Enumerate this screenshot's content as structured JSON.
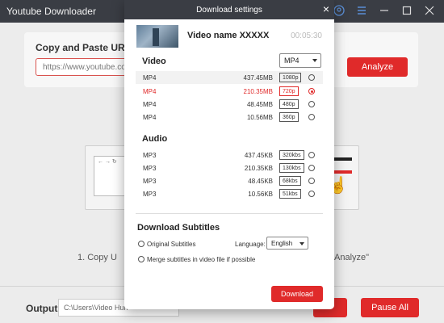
{
  "app": {
    "title": "Youtube Downloader",
    "url_section_title": "Copy and Paste URL here",
    "url_value": "https://www.youtube.com",
    "analyze_label": "Analyze",
    "step1_text": "1. Copy U",
    "step3_text": "Analyze\"",
    "output_label": "Output:",
    "output_path": "C:\\Users\\Video Hun",
    "pause_all_label": "Pause All"
  },
  "modal": {
    "title": "Download settings",
    "close_label": "×",
    "video_name": "Video name XXXXX",
    "duration": "00:05:30",
    "video_section": "Video",
    "video_format": "MP4",
    "video_rows": [
      {
        "format": "MP4",
        "size": "437.45MB",
        "quality": "1080p"
      },
      {
        "format": "MP4",
        "size": "210.35MB",
        "quality": "720p"
      },
      {
        "format": "MP4",
        "size": "48.45MB",
        "quality": "480p"
      },
      {
        "format": "MP4",
        "size": "10.56MB",
        "quality": "360p"
      }
    ],
    "audio_section": "Audio",
    "audio_rows": [
      {
        "format": "MP3",
        "size": "437.45KB",
        "quality": "320kbs"
      },
      {
        "format": "MP3",
        "size": "210.35KB",
        "quality": "130kbs"
      },
      {
        "format": "MP3",
        "size": "48.45KB",
        "quality": "68kbs"
      },
      {
        "format": "MP3",
        "size": "10.56KB",
        "quality": "51kbs"
      }
    ],
    "subtitles_section": "Download Subtitles",
    "original_subtitles": "Original Subtitles",
    "language_label": "Language:",
    "language_value": "English",
    "merge_label": "Merge subtitles in video file if possible",
    "download_label": "Download"
  },
  "colors": {
    "accent": "#e02a2a",
    "titlebar": "#3a3d44"
  },
  "icons": [
    "cart-icon",
    "user-icon",
    "menu-icon",
    "minimize-icon",
    "maximize-icon",
    "close-icon"
  ]
}
